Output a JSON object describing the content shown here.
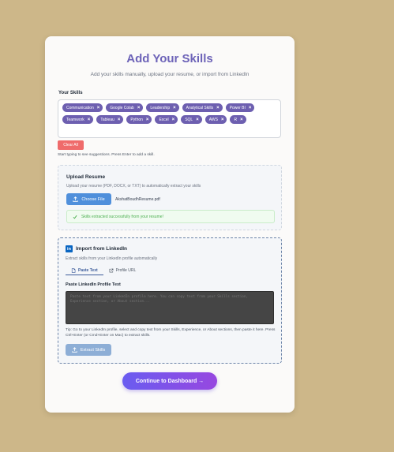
{
  "header": {
    "title": "Add Your Skills",
    "subtitle": "Add your skills manually, upload your resume, or import from LinkedIn"
  },
  "skills": {
    "label": "Your Skills",
    "chips": [
      "Communication",
      "Google Colab",
      "Leadership",
      "Analytical Skills",
      "Power BI",
      "Teamwork",
      "Tableau",
      "Python",
      "Excel",
      "SQL",
      "AWS",
      "R"
    ],
    "remove_glyph": "×",
    "clear_label": "Clear All",
    "hint": "Start typing to see suggestions. Press Enter to add a skill."
  },
  "upload": {
    "title": "Upload Resume",
    "description": "Upload your resume (PDF, DOCX, or TXT) to automatically extract your skills",
    "choose_label": "Choose File",
    "file_name": "AkshatBoudhResume.pdf",
    "success_message": "Skills extracted successfully from your resume!"
  },
  "linkedin": {
    "logo_text": "in",
    "title": "Import from LinkedIn",
    "description": "Extract skills from your LinkedIn profile automatically",
    "tabs": [
      {
        "label": "Paste Text",
        "active": true
      },
      {
        "label": "Profile URL",
        "active": false
      }
    ],
    "paste_label": "Paste LinkedIn Profile Text",
    "paste_placeholder": "Paste text from your LinkedIn profile here. You can copy text from your Skills section, Experience section, or About section...",
    "tip": "Tip: Go to your LinkedIn profile, select and copy text from your Skills, Experience, or About sections, then paste it here. Press Ctrl+Enter (or Cmd+Enter on Mac) to extract skills.",
    "extract_label": "Extract Skills"
  },
  "footer": {
    "continue_label": "Continue to Dashboard →"
  },
  "colors": {
    "accent": "#6d63b8",
    "chip": "#6d5fb0",
    "danger": "#ef6b6b",
    "primary_button": "#4f8fdb",
    "linkedin": "#0a66c2",
    "success": "#4caf50"
  }
}
